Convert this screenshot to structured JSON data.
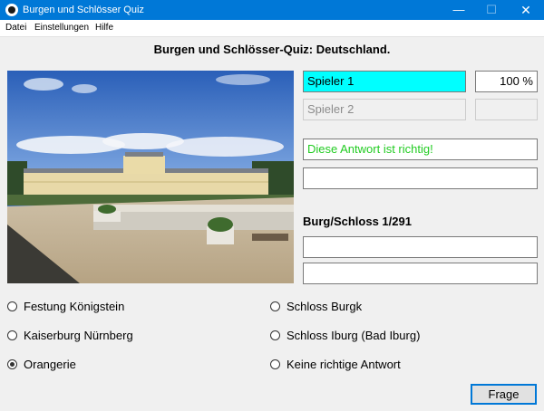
{
  "window": {
    "title": "Burgen und Schlösser Quiz",
    "minimize": "—",
    "maximize": "☐",
    "close": "✕"
  },
  "menu": [
    "Datei",
    "Einstellungen",
    "Hilfe"
  ],
  "heading": "Burgen und Schlösser-Quiz: Deutschland.",
  "players": [
    {
      "name": "Spieler 1",
      "score": "100 %",
      "active": true
    },
    {
      "name": "Spieler 2",
      "score": "",
      "active": false
    }
  ],
  "feedback": {
    "answer": "Diese Antwort ist richtig!",
    "extra": ""
  },
  "counter": "Burg/Schloss 1/291",
  "info_lines": [
    "",
    ""
  ],
  "options": [
    {
      "label": "Festung Königstein",
      "selected": false
    },
    {
      "label": "Kaiserburg Nürnberg",
      "selected": false
    },
    {
      "label": "Orangerie",
      "selected": true
    },
    {
      "label": "Schloss Burgk",
      "selected": false
    },
    {
      "label": "Schloss Iburg (Bad Iburg)",
      "selected": false
    },
    {
      "label": "Keine richtige Antwort",
      "selected": false
    }
  ],
  "submit_label": "Frage",
  "colors": {
    "active_player": "#00ffff",
    "correct": "#22cc22",
    "titlebar": "#0078d7"
  },
  "icons": {
    "app": "quiz-app-icon",
    "photo": "castle-photo"
  }
}
